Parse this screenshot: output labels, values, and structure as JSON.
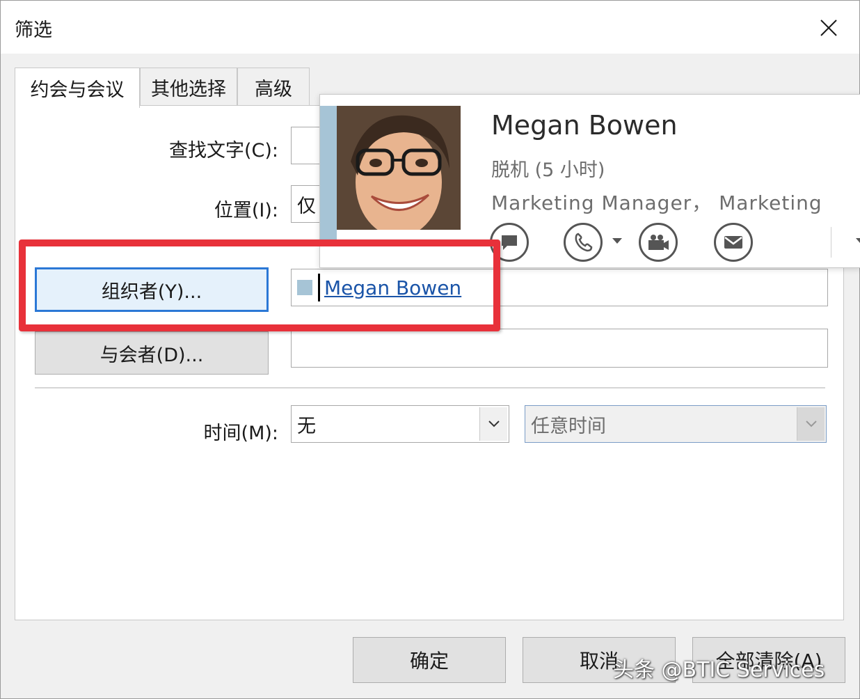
{
  "window": {
    "title": "筛选",
    "close_glyph": "✕"
  },
  "tabs": [
    {
      "label": "约会与会议",
      "active": true
    },
    {
      "label": "其他选择",
      "active": false
    },
    {
      "label": "高级",
      "active": false
    }
  ],
  "form": {
    "search_text_label": "查找文字(C):",
    "search_text_value": "",
    "location_label": "位置(I):",
    "location_value": "仅",
    "organizer_button": "组织者(Y)...",
    "organizer_value": "Megan Bowen",
    "attendees_button": "与会者(D)...",
    "attendees_value": "",
    "time_label": "时间(M):",
    "time_value": "无",
    "time_range_value": "任意时间"
  },
  "contact_card": {
    "name": "Megan Bowen",
    "status": "脱机 (5 小时)",
    "job": "Marketing Manager， Marketing",
    "actions": [
      "chat-icon",
      "phone-icon",
      "video-icon",
      "mail-icon"
    ]
  },
  "footer": {
    "ok": "确定",
    "cancel": "取消",
    "clear_all": "全部清除(A)"
  },
  "watermark": "头条 @BTIC Services",
  "colors": {
    "highlight": "#e8313a",
    "focus_border": "#2b78d6",
    "link": "#1a54a8",
    "presence": "#a6c4d6"
  }
}
